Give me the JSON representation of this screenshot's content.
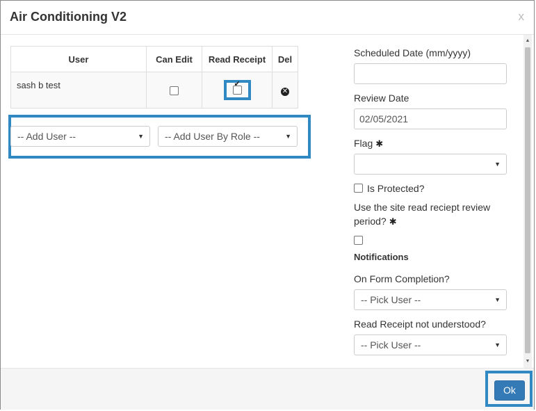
{
  "dialog": {
    "title": "Air Conditioning V2",
    "close_label": "x"
  },
  "user_table": {
    "columns": [
      "User",
      "Can Edit",
      "Read Receipt",
      "Del"
    ],
    "rows": [
      {
        "user": "sash b test",
        "can_edit": false,
        "read_receipt": true
      }
    ]
  },
  "add_user": {
    "select_label": "-- Add User --",
    "role_select_label": "-- Add User By Role --"
  },
  "form": {
    "scheduled_date_label": "Scheduled Date (mm/yyyy)",
    "scheduled_date_value": "",
    "review_date_label": "Review Date",
    "review_date_value": "02/05/2021",
    "flag_label": "Flag",
    "flag_value": "",
    "is_protected_label": "Is Protected?",
    "is_protected": false,
    "use_site_period_label_line1": "Use the site read reciept review",
    "use_site_period_label_line2": "period?",
    "use_site_period": false,
    "notifications_heading": "Notifications",
    "on_completion_label": "On Form Completion?",
    "on_completion_value": "-- Pick User --",
    "rr_not_understood_label": "Read Receipt not understood?",
    "rr_not_understood_value": "-- Pick User --"
  },
  "footer": {
    "ok_label": "Ok"
  },
  "colors": {
    "highlight": "#3089c2",
    "primary_button": "#337ab7"
  }
}
